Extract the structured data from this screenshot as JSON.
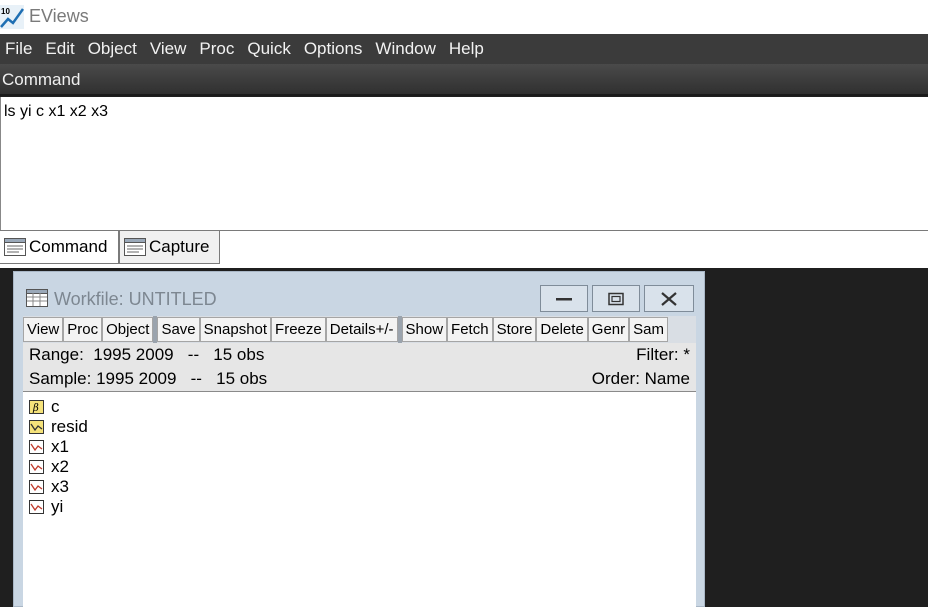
{
  "app": {
    "title": "EViews",
    "icon_badge": "10"
  },
  "menu": [
    "File",
    "Edit",
    "Object",
    "View",
    "Proc",
    "Quick",
    "Options",
    "Window",
    "Help"
  ],
  "command": {
    "header": "Command",
    "text": "ls yi c x1 x2 x3",
    "tabs": [
      {
        "label": "Command",
        "active": true
      },
      {
        "label": "Capture",
        "active": false
      }
    ]
  },
  "workfile": {
    "title": "Workfile: UNTITLED",
    "toolbar_groups": [
      [
        "View",
        "Proc",
        "Object"
      ],
      [
        "Save",
        "Snapshot",
        "Freeze",
        "Details+/-"
      ],
      [
        "Show",
        "Fetch",
        "Store",
        "Delete",
        "Genr",
        "Sam"
      ]
    ],
    "range_label": "Range:  1995 2009   --   15 obs",
    "sample_label": "Sample: 1995 2009   --   15 obs",
    "filter_label": "Filter: *",
    "order_label": "Order: Name",
    "objects": [
      {
        "name": "c",
        "kind": "coef-icon"
      },
      {
        "name": "resid",
        "kind": "series-icon"
      },
      {
        "name": "x1",
        "kind": "series-icon"
      },
      {
        "name": "x2",
        "kind": "series-icon"
      },
      {
        "name": "x3",
        "kind": "series-icon"
      },
      {
        "name": "yi",
        "kind": "series-icon"
      }
    ]
  },
  "colors": {
    "menubar": "#3b3b3b",
    "workspace": "#1f1f1f",
    "window_frame": "#c9d6e3",
    "coef_icon": "#f5e27a",
    "series_icon": "#c0392b"
  }
}
